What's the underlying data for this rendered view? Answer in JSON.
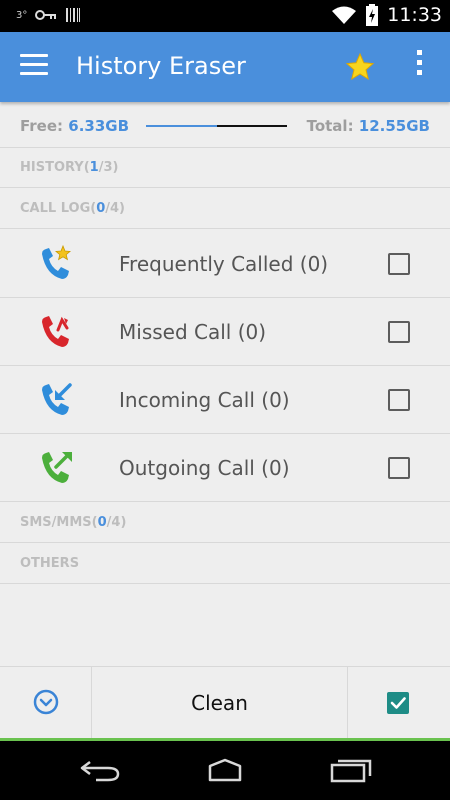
{
  "status_bar": {
    "left_text": "3°",
    "time": "11:33"
  },
  "app_bar": {
    "title": "History Eraser",
    "menu_icon": "hamburger-menu-icon",
    "favorite_icon": "star-icon",
    "overflow_icon": "more-vert-icon",
    "accent_color": "#4a8fdc"
  },
  "storage": {
    "free_label": "Free: ",
    "free_value": "6.33GB",
    "total_label": "Total: ",
    "total_value": "12.55GB",
    "used_fraction": 0.5
  },
  "sections": [
    {
      "name": "HISTORY",
      "open": "(",
      "selected": "1",
      "rest": "/3)"
    },
    {
      "name": "CALL LOG",
      "open": "(",
      "selected": "0",
      "rest": "/4)"
    },
    {
      "name": "SMS/MMS",
      "open": "(",
      "selected": "0",
      "rest": "/4)"
    },
    {
      "name": "OTHERS",
      "open": "",
      "selected": "",
      "rest": ""
    }
  ],
  "call_log_items": [
    {
      "label": "Frequently Called (0)",
      "icon": "phone-star-icon",
      "checked": false
    },
    {
      "label": "Missed Call (0)",
      "icon": "phone-missed-icon",
      "checked": false
    },
    {
      "label": "Incoming Call (0)",
      "icon": "phone-incoming-icon",
      "checked": false
    },
    {
      "label": "Outgoing Call (0)",
      "icon": "phone-outgoing-icon",
      "checked": false
    }
  ],
  "bottom_bar": {
    "expand_icon": "expand-circle-icon",
    "clean_label": "Clean",
    "select_all_checked": true,
    "check_color": "#1e8c86",
    "accent_line_color": "#6ac24f"
  },
  "nav_bar": {
    "back_icon": "back-icon",
    "home_icon": "home-icon",
    "recents_icon": "recents-icon"
  }
}
